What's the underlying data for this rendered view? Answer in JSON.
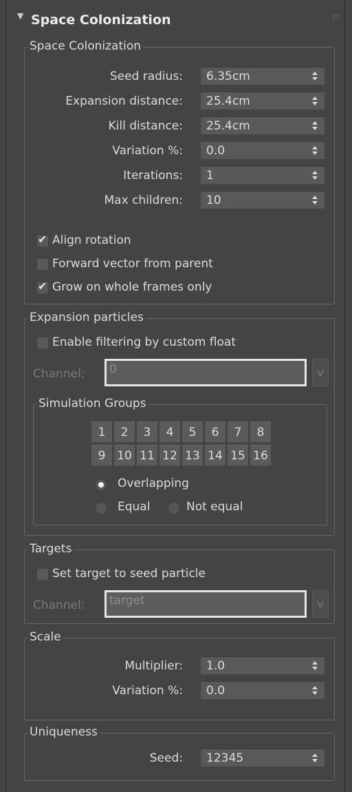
{
  "rollout": {
    "title": "Space Colonization"
  },
  "space_colonization": {
    "group_title": "Space Colonization",
    "fields": [
      {
        "label": "Seed radius:",
        "value": "6.35cm"
      },
      {
        "label": "Expansion distance:",
        "value": "25.4cm"
      },
      {
        "label": "Kill distance:",
        "value": "25.4cm"
      },
      {
        "label": "Variation %:",
        "value": "0.0"
      },
      {
        "label": "Iterations:",
        "value": "1"
      },
      {
        "label": "Max children:",
        "value": "10"
      }
    ],
    "checks": [
      {
        "label": "Align rotation",
        "checked": true
      },
      {
        "label": "Forward vector from parent",
        "checked": false
      },
      {
        "label": "Grow on whole frames only",
        "checked": true
      }
    ]
  },
  "expansion_particles": {
    "group_title": "Expansion particles",
    "filter_check": {
      "label": "Enable filtering by custom float",
      "checked": false
    },
    "channel_label": "Channel:",
    "channel_value": "0",
    "channel_button": "v",
    "simulation_groups": {
      "title": "Simulation Groups",
      "row1": [
        "1",
        "2",
        "3",
        "4",
        "5",
        "6",
        "7",
        "8"
      ],
      "row2": [
        "9",
        "10",
        "11",
        "12",
        "13",
        "14",
        "15",
        "16"
      ],
      "radio_overlapping": "Overlapping",
      "radio_equal": "Equal",
      "radio_not_equal": "Not equal",
      "selected": "Overlapping"
    }
  },
  "targets": {
    "group_title": "Targets",
    "check": {
      "label": "Set target to seed particle",
      "checked": false
    },
    "channel_label": "Channel:",
    "channel_value": "target",
    "channel_button": "v"
  },
  "scale": {
    "group_title": "Scale",
    "multiplier_label": "Multiplier:",
    "multiplier_value": "1.0",
    "variation_label": "Variation %:",
    "variation_value": "0.0"
  },
  "uniqueness": {
    "group_title": "Uniqueness",
    "seed_label": "Seed:",
    "seed_value": "12345"
  },
  "colors": {
    "background": "#444444",
    "spinner_bg": "#595959",
    "text": "#dcdcdc",
    "disabled_text": "#7b7b7b"
  }
}
